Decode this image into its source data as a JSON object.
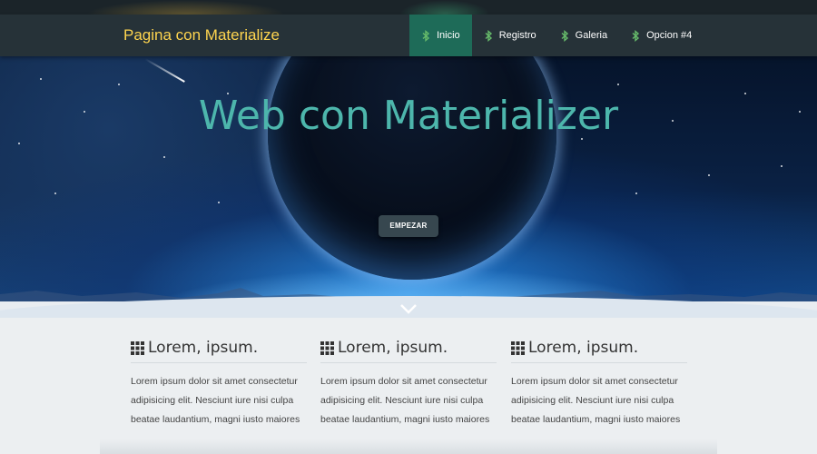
{
  "nav": {
    "brand": "Pagina con Materialize",
    "items": [
      {
        "label": "Inicio",
        "icon": "bluetooth-icon",
        "active": true
      },
      {
        "label": "Registro",
        "icon": "bluetooth-icon",
        "active": false
      },
      {
        "label": "Galeria",
        "icon": "bluetooth-icon",
        "active": false
      },
      {
        "label": "Opcion #4",
        "icon": "bluetooth-icon",
        "active": false
      }
    ]
  },
  "hero": {
    "title": "Web con Materializer",
    "button_label": "EMPEZAR",
    "scroll_icon": "chevron-down-icon"
  },
  "features": [
    {
      "icon": "apps-grid-icon",
      "title": "Lorem, ipsum.",
      "text": "Lorem ipsum dolor sit amet consectetur adipisicing elit. Nesciunt iure nisi culpa beatae laudantium, magni iusto maiores"
    },
    {
      "icon": "apps-grid-icon",
      "title": "Lorem, ipsum.",
      "text": "Lorem ipsum dolor sit amet consectetur adipisicing elit. Nesciunt iure nisi culpa beatae laudantium, magni iusto maiores"
    },
    {
      "icon": "apps-grid-icon",
      "title": "Lorem, ipsum.",
      "text": "Lorem ipsum dolor sit amet consectetur adipisicing elit. Nesciunt iure nisi culpa beatae laudantium, magni iusto maiores"
    }
  ],
  "colors": {
    "nav_bg": "#263238",
    "brand": "#ffd54f",
    "active_item": "#1e6b58",
    "icon_green": "#66bb6a",
    "hero_title": "#4db6ac",
    "button_bg": "#37474f"
  }
}
